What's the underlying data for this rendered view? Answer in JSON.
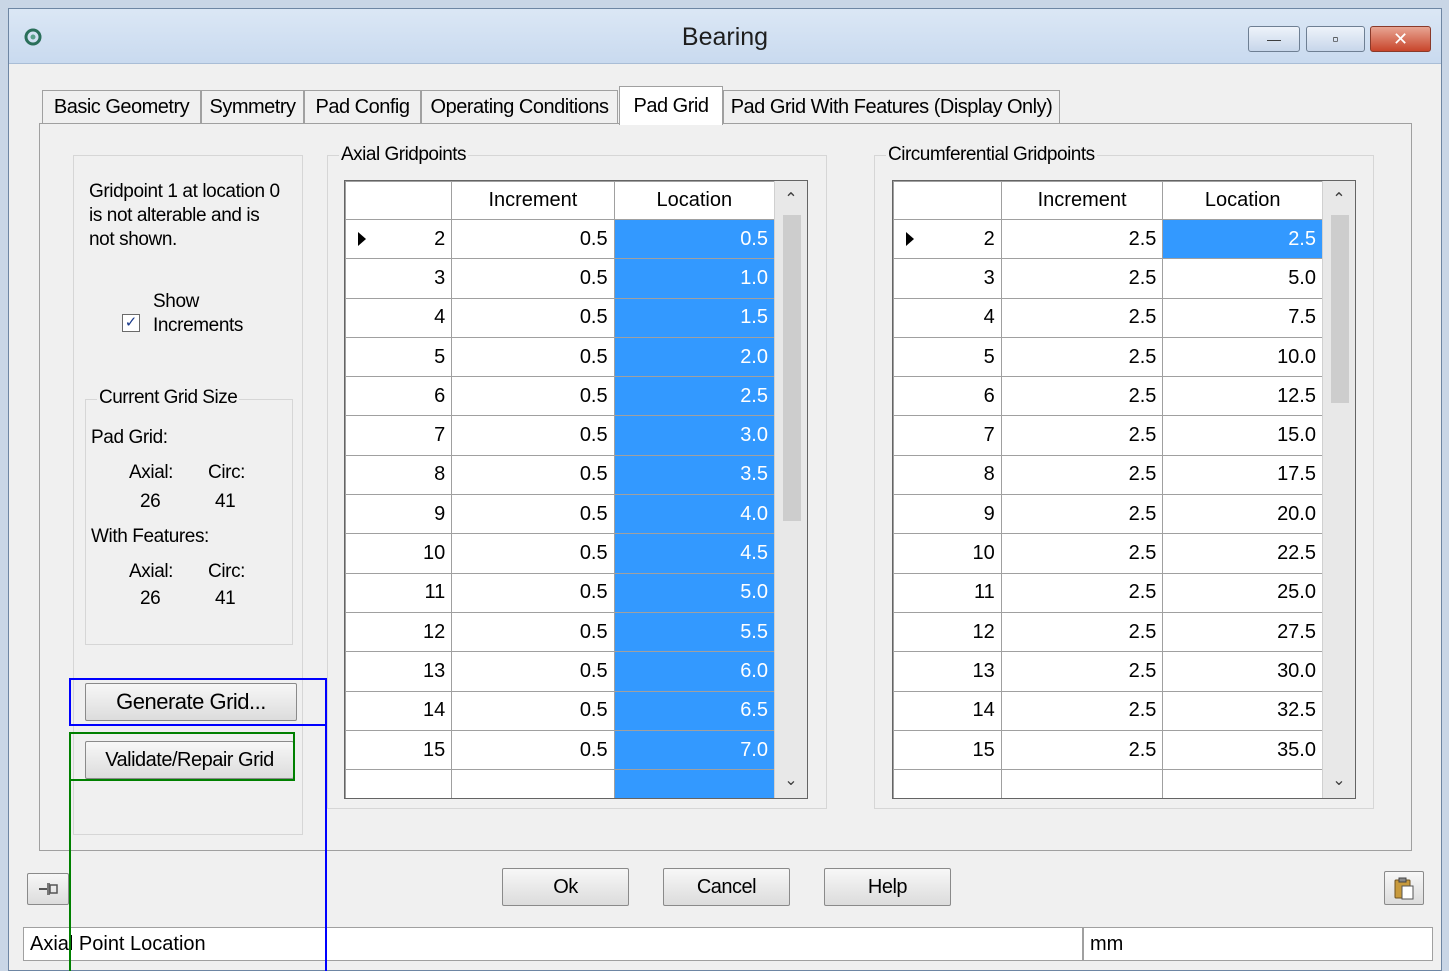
{
  "window": {
    "title": "Bearing",
    "close_glyph": "✕",
    "minimize_glyph": "—",
    "maximize_glyph": "▫"
  },
  "tabs": [
    {
      "label": "Basic Geometry"
    },
    {
      "label": "Symmetry"
    },
    {
      "label": "Pad Config"
    },
    {
      "label": "Operating Conditions"
    },
    {
      "label": "Pad Grid",
      "active": true
    },
    {
      "label": "Pad Grid With Features (Display Only)"
    }
  ],
  "left_panel": {
    "note": [
      "Gridpoint 1 at location 0",
      "is not alterable and is",
      "not shown."
    ],
    "show_increments": {
      "line1": "Show",
      "line2": "Increments",
      "checked": true,
      "check_glyph": "✓"
    },
    "grid_size": {
      "legend": "Current Grid Size",
      "pad_grid_label": "Pad Grid:",
      "axial_label": "Axial:",
      "circ_label": "Circ:",
      "pad_axial": "26",
      "pad_circ": "41",
      "features_label": "With Features:",
      "feat_axial": "26",
      "feat_circ": "41"
    },
    "generate_button": "Generate Grid...",
    "validate_button": "Validate/Repair Grid"
  },
  "axial": {
    "legend": "Axial Gridpoints",
    "headers": [
      "",
      "Increment",
      "Location"
    ],
    "rows": [
      [
        "2",
        "0.5",
        "0.5"
      ],
      [
        "3",
        "0.5",
        "1.0"
      ],
      [
        "4",
        "0.5",
        "1.5"
      ],
      [
        "5",
        "0.5",
        "2.0"
      ],
      [
        "6",
        "0.5",
        "2.5"
      ],
      [
        "7",
        "0.5",
        "3.0"
      ],
      [
        "8",
        "0.5",
        "3.5"
      ],
      [
        "9",
        "0.5",
        "4.0"
      ],
      [
        "10",
        "0.5",
        "4.5"
      ],
      [
        "11",
        "0.5",
        "5.0"
      ],
      [
        "12",
        "0.5",
        "5.5"
      ],
      [
        "13",
        "0.5",
        "6.0"
      ],
      [
        "14",
        "0.5",
        "6.5"
      ],
      [
        "15",
        "0.5",
        "7.0"
      ]
    ]
  },
  "circumferential": {
    "legend": "Circumferential Gridpoints",
    "headers": [
      "",
      "Increment",
      "Location"
    ],
    "rows": [
      [
        "2",
        "2.5",
        "2.5"
      ],
      [
        "3",
        "2.5",
        "5.0"
      ],
      [
        "4",
        "2.5",
        "7.5"
      ],
      [
        "5",
        "2.5",
        "10.0"
      ],
      [
        "6",
        "2.5",
        "12.5"
      ],
      [
        "7",
        "2.5",
        "15.0"
      ],
      [
        "8",
        "2.5",
        "17.5"
      ],
      [
        "9",
        "2.5",
        "20.0"
      ],
      [
        "10",
        "2.5",
        "22.5"
      ],
      [
        "11",
        "2.5",
        "25.0"
      ],
      [
        "12",
        "2.5",
        "27.5"
      ],
      [
        "13",
        "2.5",
        "30.0"
      ],
      [
        "14",
        "2.5",
        "32.5"
      ],
      [
        "15",
        "2.5",
        "35.0"
      ]
    ]
  },
  "bottom_buttons": {
    "ok": "Ok",
    "cancel": "Cancel",
    "help": "Help"
  },
  "status": {
    "description": "Axial Point Location",
    "units": "mm"
  },
  "icons": {
    "pin": "pin-icon",
    "clipboard": "clipboard-icon",
    "app": "bearing-icon",
    "scroll_up": "⌃",
    "scroll_down": "⌄"
  },
  "colors": {
    "selection": "#3399ff",
    "highlight_blue": "#0000ff",
    "highlight_green": "#008000"
  }
}
